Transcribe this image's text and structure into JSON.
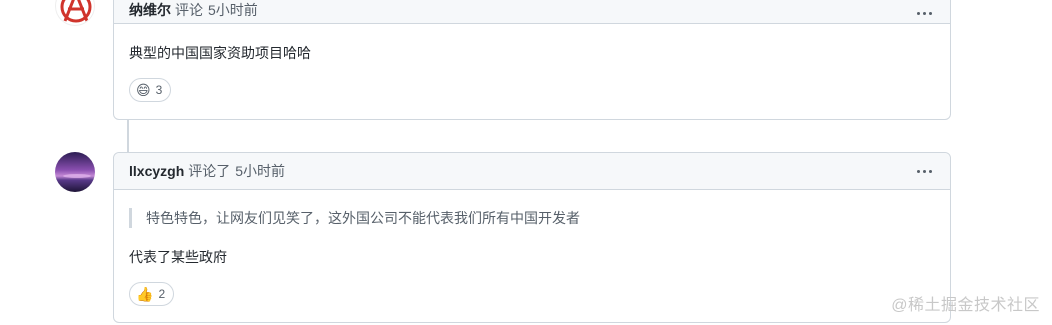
{
  "comments": [
    {
      "author": "纳维尔",
      "action": "评论",
      "time": "5小时前",
      "body": "典型的中国国家资助项目哈哈",
      "reaction": {
        "icon": "laugh-emoji-icon",
        "emoji": "😄",
        "count": "3"
      }
    },
    {
      "author": "llxcyzgh",
      "action": "评论了",
      "time": "5小时前",
      "quote": "特色特色，让网友们见笑了，这外国公司不能代表我们所有中国开发者",
      "body": "代表了某些政府",
      "reaction": {
        "icon": "thumbs-up-emoji-icon",
        "emoji": "👍",
        "count": "2"
      }
    }
  ],
  "watermark": "@稀土掘金技术社区",
  "colors": {
    "border": "#d0d7de",
    "header_bg": "#f6f8fa",
    "muted": "#57606a",
    "avatar1_red": "#d0342c"
  }
}
